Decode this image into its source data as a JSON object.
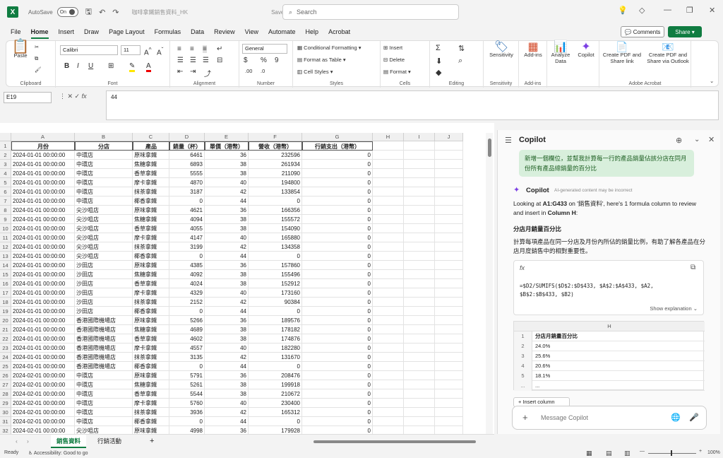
{
  "titlebar": {
    "autosave_label": "AutoSave",
    "autosave_state": "On",
    "filename": "咖啡拿鐵銷售資料_HK",
    "saved_status": "Saved",
    "search_placeholder": "Search"
  },
  "menus": [
    "File",
    "Home",
    "Insert",
    "Draw",
    "Page Layout",
    "Formulas",
    "Data",
    "Review",
    "View",
    "Automate",
    "Help",
    "Acrobat"
  ],
  "active_menu": "Home",
  "comments_label": "Comments",
  "share_label": "Share",
  "ribbon": {
    "clipboard": {
      "paste": "Paste",
      "label": "Clipboard"
    },
    "font": {
      "name": "Calibri",
      "size": "11",
      "label": "Font"
    },
    "alignment": {
      "label": "Alignment"
    },
    "number": {
      "format": "General",
      "label": "Number"
    },
    "styles": {
      "conditional": "Conditional Formatting",
      "format_table": "Format as Table",
      "cell_styles": "Cell Styles",
      "label": "Styles"
    },
    "cells": {
      "insert": "Insert",
      "delete": "Delete",
      "format": "Format",
      "label": "Cells"
    },
    "editing": {
      "label": "Editing"
    },
    "sensitivity": {
      "btn": "Sensitivity",
      "label": "Sensitivity"
    },
    "addins": {
      "btn": "Add-ins",
      "label": "Add-ins"
    },
    "analyze": "Analyze Data",
    "copilot": "Copilot",
    "acrobat": {
      "pdf_link": "Create PDF and Share link",
      "pdf_outlook": "Create PDF and Share via Outlook",
      "label": "Adobe Acrobat"
    }
  },
  "formula_bar": {
    "cell_ref": "E19",
    "fx": "fx",
    "value": "44"
  },
  "columns": [
    "A",
    "B",
    "C",
    "D",
    "E",
    "F",
    "G",
    "H",
    "I",
    "J"
  ],
  "header_row": [
    "月份",
    "分店",
    "產品",
    "銷量（杯）",
    "單價（港幣）",
    "營收（港幣）",
    "行銷支出（港幣）"
  ],
  "rows": [
    [
      "2024-01-01 00:00:00",
      "中環店",
      "原味拿鐵",
      "6461",
      "36",
      "232596",
      "0"
    ],
    [
      "2024-01-01 00:00:00",
      "中環店",
      "焦糖拿鐵",
      "6893",
      "38",
      "261934",
      "0"
    ],
    [
      "2024-01-01 00:00:00",
      "中環店",
      "香草拿鐵",
      "5555",
      "38",
      "211090",
      "0"
    ],
    [
      "2024-01-01 00:00:00",
      "中環店",
      "摩卡拿鐵",
      "4870",
      "40",
      "194800",
      "0"
    ],
    [
      "2024-01-01 00:00:00",
      "中環店",
      "抹茶拿鐵",
      "3187",
      "42",
      "133854",
      "0"
    ],
    [
      "2024-01-01 00:00:00",
      "中環店",
      "椰香拿鐵",
      "0",
      "44",
      "0",
      "0"
    ],
    [
      "2024-01-01 00:00:00",
      "尖沙咀店",
      "原味拿鐵",
      "4621",
      "36",
      "166356",
      "0"
    ],
    [
      "2024-01-01 00:00:00",
      "尖沙咀店",
      "焦糖拿鐵",
      "4094",
      "38",
      "155572",
      "0"
    ],
    [
      "2024-01-01 00:00:00",
      "尖沙咀店",
      "香草拿鐵",
      "4055",
      "38",
      "154090",
      "0"
    ],
    [
      "2024-01-01 00:00:00",
      "尖沙咀店",
      "摩卡拿鐵",
      "4147",
      "40",
      "165880",
      "0"
    ],
    [
      "2024-01-01 00:00:00",
      "尖沙咀店",
      "抹茶拿鐵",
      "3199",
      "42",
      "134358",
      "0"
    ],
    [
      "2024-01-01 00:00:00",
      "尖沙咀店",
      "椰香拿鐵",
      "0",
      "44",
      "0",
      "0"
    ],
    [
      "2024-01-01 00:00:00",
      "沙田店",
      "原味拿鐵",
      "4385",
      "36",
      "157860",
      "0"
    ],
    [
      "2024-01-01 00:00:00",
      "沙田店",
      "焦糖拿鐵",
      "4092",
      "38",
      "155496",
      "0"
    ],
    [
      "2024-01-01 00:00:00",
      "沙田店",
      "香草拿鐵",
      "4024",
      "38",
      "152912",
      "0"
    ],
    [
      "2024-01-01 00:00:00",
      "沙田店",
      "摩卡拿鐵",
      "4329",
      "40",
      "173160",
      "0"
    ],
    [
      "2024-01-01 00:00:00",
      "沙田店",
      "抹茶拿鐵",
      "2152",
      "42",
      "90384",
      "0"
    ],
    [
      "2024-01-01 00:00:00",
      "沙田店",
      "椰香拿鐵",
      "0",
      "44",
      "0",
      "0"
    ],
    [
      "2024-01-01 00:00:00",
      "香港國際機場店",
      "原味拿鐵",
      "5266",
      "36",
      "189576",
      "0"
    ],
    [
      "2024-01-01 00:00:00",
      "香港國際機場店",
      "焦糖拿鐵",
      "4689",
      "38",
      "178182",
      "0"
    ],
    [
      "2024-01-01 00:00:00",
      "香港國際機場店",
      "香草拿鐵",
      "4602",
      "38",
      "174876",
      "0"
    ],
    [
      "2024-01-01 00:00:00",
      "香港國際機場店",
      "摩卡拿鐵",
      "4557",
      "40",
      "182280",
      "0"
    ],
    [
      "2024-01-01 00:00:00",
      "香港國際機場店",
      "抹茶拿鐵",
      "3135",
      "42",
      "131670",
      "0"
    ],
    [
      "2024-01-01 00:00:00",
      "香港國際機場店",
      "椰香拿鐵",
      "0",
      "44",
      "0",
      "0"
    ],
    [
      "2024-02-01 00:00:00",
      "中環店",
      "原味拿鐵",
      "5791",
      "36",
      "208476",
      "0"
    ],
    [
      "2024-02-01 00:00:00",
      "中環店",
      "焦糖拿鐵",
      "5261",
      "38",
      "199918",
      "0"
    ],
    [
      "2024-02-01 00:00:00",
      "中環店",
      "香草拿鐵",
      "5544",
      "38",
      "210672",
      "0"
    ],
    [
      "2024-02-01 00:00:00",
      "中環店",
      "摩卡拿鐵",
      "5760",
      "40",
      "230400",
      "0"
    ],
    [
      "2024-02-01 00:00:00",
      "中環店",
      "抹茶拿鐵",
      "3936",
      "42",
      "165312",
      "0"
    ],
    [
      "2024-02-01 00:00:00",
      "中環店",
      "椰香拿鐵",
      "0",
      "44",
      "0",
      "0"
    ],
    [
      "2024-02-01 00:00:00",
      "尖沙咀店",
      "原味拿鐵",
      "4998",
      "36",
      "179928",
      "0"
    ]
  ],
  "sheet_tabs": [
    "銷售資料",
    "行銷活動"
  ],
  "active_sheet": "銷售資料",
  "status": {
    "ready": "Ready",
    "accessibility": "Accessibility: Good to go",
    "zoom": "100%"
  },
  "copilot": {
    "title": "Copilot",
    "user_message": "新增一個欄位，並幫我計算每一行的產品銷量佔該分店在同月份所有產品總銷量的百分比",
    "assistant_name": "Copilot",
    "ai_note": "AI-generated content may be incorrect",
    "intro_pre": "Looking at ",
    "intro_range": "A1:G433",
    "intro_mid": " on '銷售資料', here's 1 formula column to review and insert in ",
    "intro_col": "Column H",
    "intro_end": ":",
    "section_title": "分店月銷量百分比",
    "section_desc": "計算每項產品在同一分店及月份內所佔的銷量比例，有助了解各產品在分店月度銷售中的相對重要性。",
    "fx_label": "fx",
    "formula_line1": "=$D2/SUMIFS($D$2:$D$433, $A$2:$A$433, $A2,",
    "formula_line2": "$B$2:$B$433, $B2)",
    "show_explanation": "Show explanation",
    "preview_col": "H",
    "preview_rows": [
      {
        "n": "1",
        "v": "分店月銷量百分比"
      },
      {
        "n": "2",
        "v": "24.0%"
      },
      {
        "n": "3",
        "v": "25.6%"
      },
      {
        "n": "4",
        "v": "20.6%"
      },
      {
        "n": "5",
        "v": "18.1%"
      },
      {
        "n": "...",
        "v": "..."
      }
    ],
    "insert_column": "Insert column",
    "message_placeholder": "Message Copilot"
  }
}
